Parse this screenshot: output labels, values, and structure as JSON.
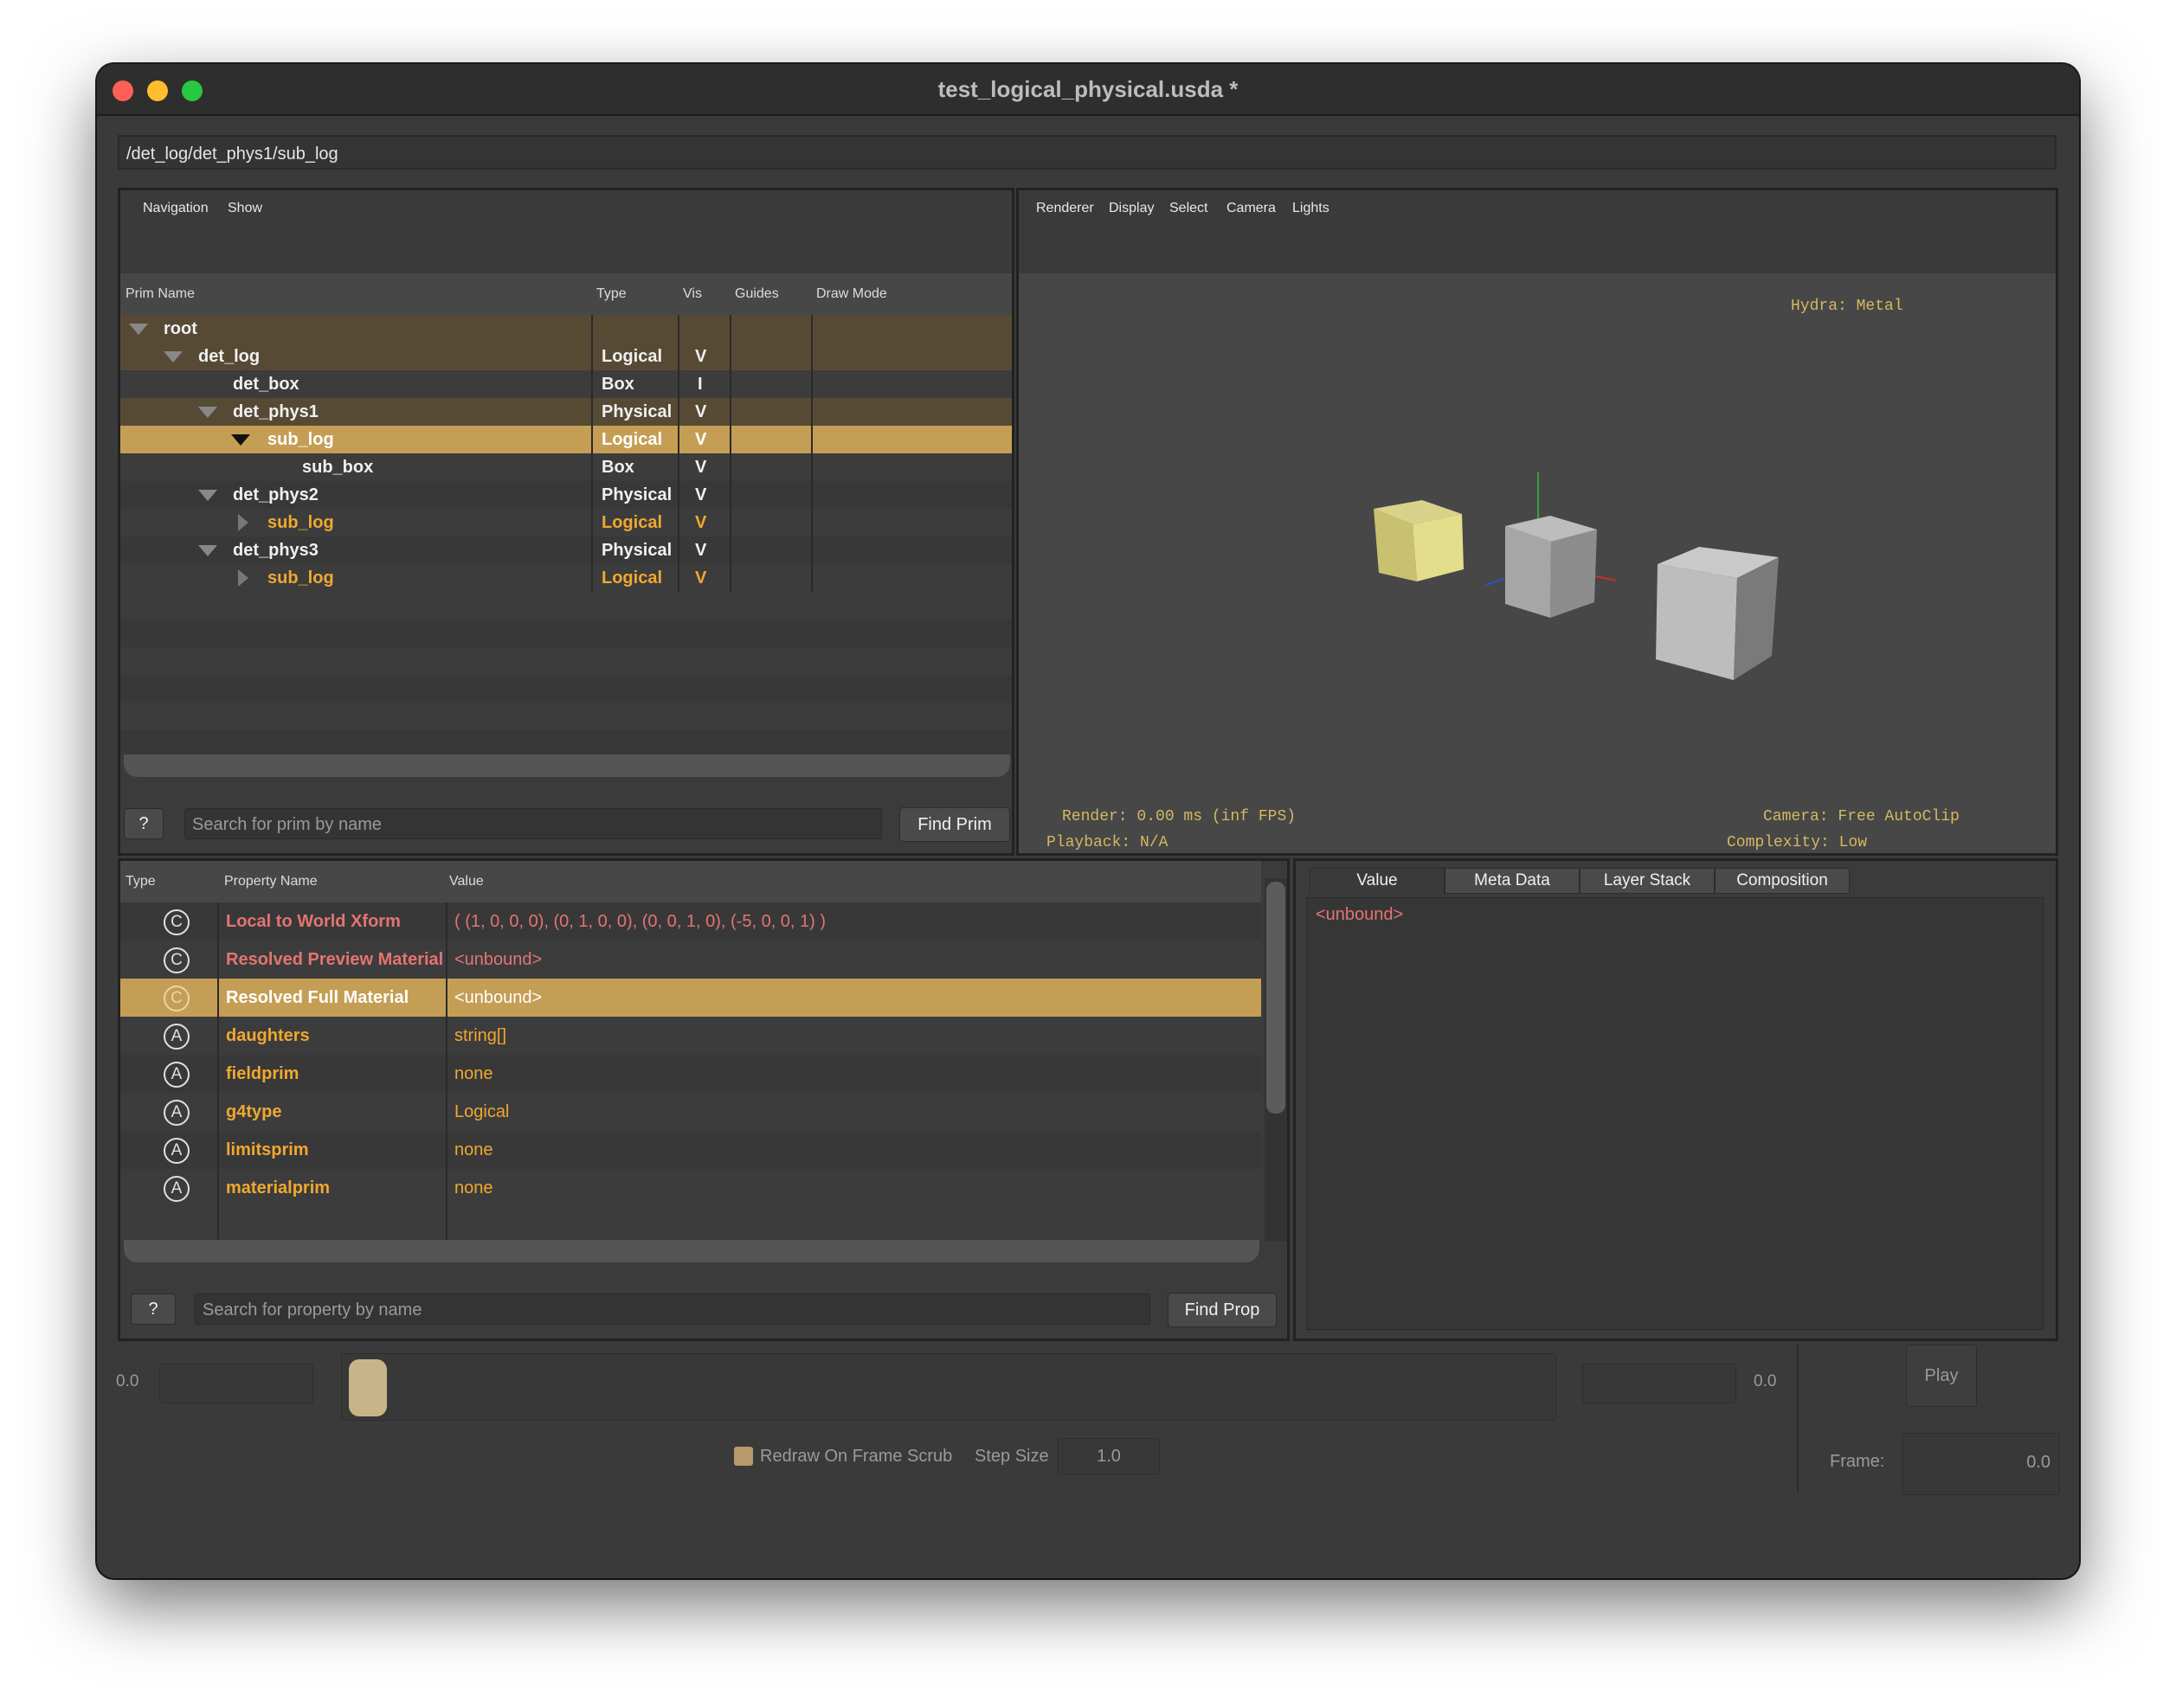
{
  "window": {
    "title": "test_logical_physical.usda *"
  },
  "colors": {
    "accent": "#c59e55",
    "orange": "#f0a830",
    "red": "#e57373",
    "viewport_text": "#d4b860"
  },
  "path_bar": "/det_log/det_phys1/sub_log",
  "prim_browser": {
    "menu": [
      "Navigation",
      "Show"
    ],
    "columns": [
      "Prim Name",
      "Type",
      "Vis",
      "Guides",
      "Draw Mode"
    ],
    "rows": [
      {
        "name": "root",
        "type": "",
        "vis": ""
      },
      {
        "name": "det_log",
        "type": "Logical",
        "vis": "V"
      },
      {
        "name": "det_box",
        "type": "Box",
        "vis": "I"
      },
      {
        "name": "det_phys1",
        "type": "Physical",
        "vis": "V"
      },
      {
        "name": "sub_log",
        "type": "Logical",
        "vis": "V"
      },
      {
        "name": "sub_box",
        "type": "Box",
        "vis": "V"
      },
      {
        "name": "det_phys2",
        "type": "Physical",
        "vis": "V"
      },
      {
        "name": "sub_log",
        "type": "Logical",
        "vis": "V"
      },
      {
        "name": "det_phys3",
        "type": "Physical",
        "vis": "V"
      },
      {
        "name": "sub_log",
        "type": "Logical",
        "vis": "V"
      }
    ],
    "help_label": "?",
    "search_placeholder": "Search for prim by name",
    "find_label": "Find Prim"
  },
  "viewport": {
    "menu": [
      "Renderer",
      "Display",
      "Select",
      "Camera",
      "Lights"
    ],
    "hydra": "Hydra: Metal",
    "render": "Render: 0.00 ms (inf FPS)",
    "playback": "Playback: N/A",
    "camera": "Camera: Free AutoClip",
    "complexity": "Complexity: Low"
  },
  "properties": {
    "columns": [
      "Type",
      "Property Name",
      "Value"
    ],
    "rows": [
      {
        "icon": "C",
        "name": "Local to World Xform",
        "value": "( (1, 0, 0, 0), (0, 1, 0, 0), (0, 0, 1, 0), (-5, 0, 0, 1) )"
      },
      {
        "icon": "C",
        "name": "Resolved Preview Material",
        "value": "<unbound>"
      },
      {
        "icon": "C",
        "name": "Resolved Full Material",
        "value": "<unbound>"
      },
      {
        "icon": "A",
        "name": "daughters",
        "value": "string[]"
      },
      {
        "icon": "A",
        "name": "fieldprim",
        "value": "none"
      },
      {
        "icon": "A",
        "name": "g4type",
        "value": "Logical"
      },
      {
        "icon": "A",
        "name": "limitsprim",
        "value": "none"
      },
      {
        "icon": "A",
        "name": "materialprim",
        "value": "none"
      }
    ],
    "help_label": "?",
    "search_placeholder": "Search for property by name",
    "find_label": "Find Prop"
  },
  "details": {
    "tabs": [
      "Value",
      "Meta Data",
      "Layer Stack",
      "Composition"
    ],
    "value_text": "<unbound>"
  },
  "timeline": {
    "start": "0.0",
    "end": "0.0",
    "redraw_label": "Redraw On Frame Scrub",
    "step_label": "Step Size",
    "step_value": "1.0",
    "play_label": "Play",
    "frame_label": "Frame:",
    "frame_value": "0.0"
  }
}
